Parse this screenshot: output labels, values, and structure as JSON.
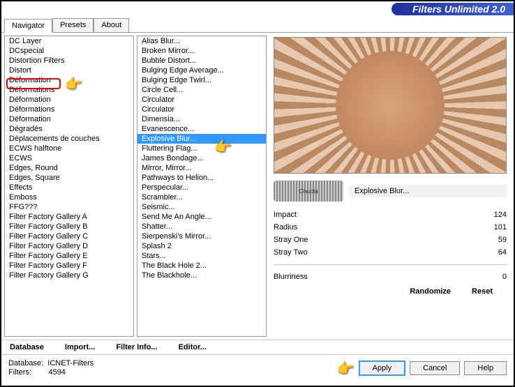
{
  "title": "Filters Unlimited 2.0",
  "tabs": [
    {
      "label": "Navigator",
      "active": true
    },
    {
      "label": "Presets",
      "active": false
    },
    {
      "label": "About",
      "active": false
    }
  ],
  "categories": [
    "DC Layer",
    "DCspecial",
    "Distortion Filters",
    "Distort",
    "Déformation",
    "Déformations",
    "Déformation",
    "Déformations",
    "Déformation",
    "Dégradés",
    "Déplacements de couches",
    "ECWS halftone",
    "ECWS",
    "Edges, Round",
    "Edges, Square",
    "Effects",
    "Emboss",
    "FFG???",
    "Filter Factory Gallery A",
    "Filter Factory Gallery B",
    "Filter Factory Gallery C",
    "Filter Factory Gallery D",
    "Filter Factory Gallery E",
    "Filter Factory Gallery F",
    "Filter Factory Gallery G"
  ],
  "filters": [
    "Alias Blur...",
    "Broken Mirror...",
    "Bubble Distort...",
    "Bulging Edge Average...",
    "Bulging Edge Twirl...",
    "Circle Cell...",
    "Circulator",
    "Circulator",
    "Dimensia...",
    "Evanescence...",
    "Explosive Blur...",
    "Fluttering Flag...",
    "James Bondage...",
    "Mirror, Mirror...",
    "Pathways to Helion...",
    "Perspecular...",
    "Scrambler...",
    "Seismic...",
    "Send Me An Angle...",
    "Shatter...",
    "Sierpenski's Mirror...",
    "Splash 2",
    "Stars...",
    "The Black Hole 2...",
    "The Blackhole..."
  ],
  "selected_filter_index": 10,
  "highlight_category_index": 4,
  "current_filter_name": "Explosive Blur...",
  "watermark_text": "Claudia",
  "params": [
    {
      "label": "Impact",
      "value": 124,
      "pos": 48
    },
    {
      "label": "Radius",
      "value": 101,
      "pos": 40
    },
    {
      "label": "Stray One",
      "value": 59,
      "pos": 23
    },
    {
      "label": "Stray Two",
      "value": 64,
      "pos": 25
    }
  ],
  "extra_param": {
    "label": "Blurriness",
    "value": 0
  },
  "bottom_buttons": {
    "database": "Database",
    "import": "Import...",
    "filterinfo": "Filter Info...",
    "editor": "Editor..."
  },
  "right_actions": {
    "randomize": "Randomize",
    "reset": "Reset"
  },
  "footer_buttons": {
    "apply": "Apply",
    "cancel": "Cancel",
    "help": "Help"
  },
  "status": {
    "db_label": "Database:",
    "db_value": "ICNET-Filters",
    "flt_label": "Filters:",
    "flt_value": "4594"
  }
}
